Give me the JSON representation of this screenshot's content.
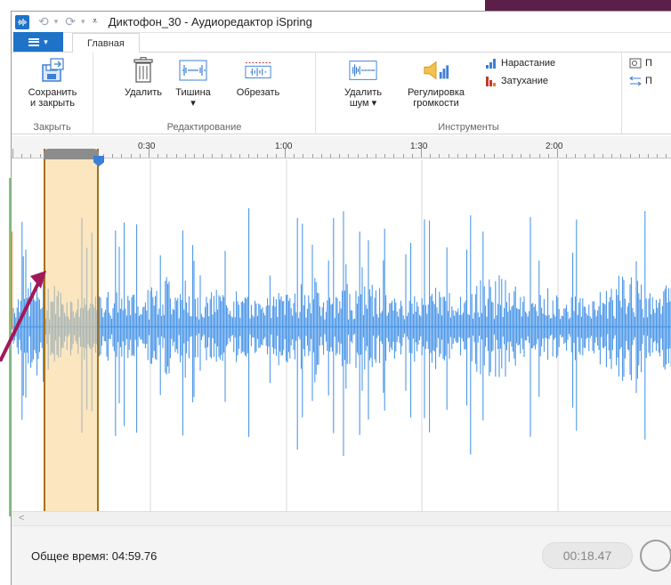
{
  "window": {
    "title": "Диктофон_30 - Аудиоредактор iSpring"
  },
  "tabs": {
    "active": "Главная"
  },
  "ribbon": {
    "groups": [
      {
        "label": "Закрыть",
        "buttons": [
          {
            "label1": "Сохранить",
            "label2": "и закрыть"
          }
        ]
      },
      {
        "label": "Редактирование",
        "buttons": [
          {
            "label1": "Удалить",
            "label2": ""
          },
          {
            "label1": "Тишина",
            "label2": "▾"
          },
          {
            "label1": "Обрезать",
            "label2": ""
          }
        ]
      },
      {
        "label": "Инструменты",
        "buttons": [
          {
            "label1": "Удалить",
            "label2": "шум ▾"
          },
          {
            "label1": "Регулировка",
            "label2": "громкости"
          }
        ],
        "small": [
          {
            "label": "Нарастание"
          },
          {
            "label": "Затухание"
          }
        ]
      },
      {
        "label": "",
        "small": [
          {
            "label": "П"
          },
          {
            "label": "П"
          }
        ]
      }
    ]
  },
  "timeline": {
    "ticks": [
      {
        "label": "0:30"
      },
      {
        "label": "1:00"
      },
      {
        "label": "1:30"
      },
      {
        "label": "2:00"
      }
    ]
  },
  "status": {
    "total_time": "Общее время: 04:59.76",
    "current_time": "00:18.47"
  },
  "colors": {
    "accent": "#1e73c9",
    "waveform": "#3d8ee6",
    "selection": "#fad28c",
    "selection_border": "#a3701f"
  },
  "icons": {
    "save": "save-close-icon",
    "delete": "trash-icon",
    "silence": "silence-icon",
    "trim": "trim-icon",
    "noise": "noise-remove-icon",
    "volume": "volume-icon",
    "fade_in": "fade-in-icon",
    "fade_out": "fade-out-icon"
  }
}
